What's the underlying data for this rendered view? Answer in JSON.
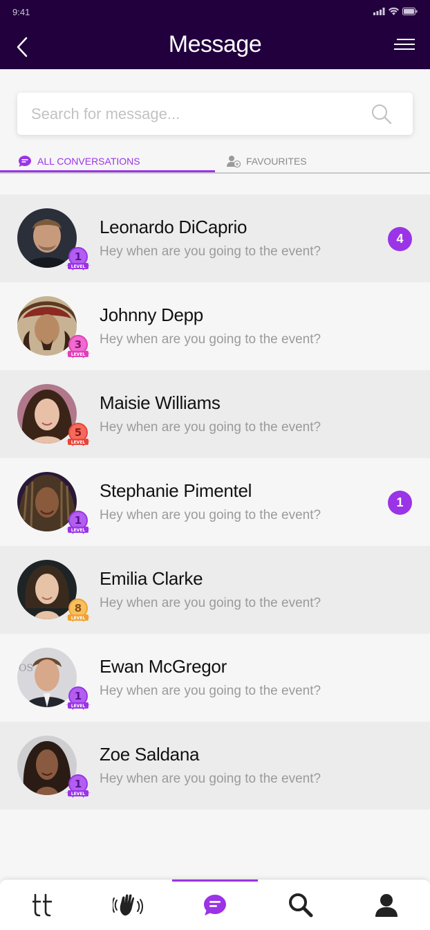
{
  "status_bar": {
    "time": "9:41"
  },
  "header": {
    "title": "Message"
  },
  "search": {
    "placeholder": "Search for message..."
  },
  "tabs": [
    {
      "label": "ALL CONVERSATIONS",
      "active": true
    },
    {
      "label": "FAVOURITES",
      "active": false
    }
  ],
  "level_label": "LEVEL",
  "conversations": [
    {
      "name": "Leonardo DiCaprio",
      "preview": "Hey when are you going to the event?",
      "level": "1",
      "level_color": "#9a34e6",
      "unread": "4"
    },
    {
      "name": "Johnny Depp",
      "preview": "Hey when are you going to the event?",
      "level": "3",
      "level_color": "#e040b8",
      "unread": ""
    },
    {
      "name": "Maisie Williams",
      "preview": "Hey when are you going to the event?",
      "level": "5",
      "level_color": "#e8443a",
      "unread": ""
    },
    {
      "name": "Stephanie Pimentel",
      "preview": "Hey when are you going to the event?",
      "level": "1",
      "level_color": "#9a34e6",
      "unread": "1"
    },
    {
      "name": "Emilia Clarke",
      "preview": "Hey when are you going to the event?",
      "level": "8",
      "level_color": "#f0a030",
      "unread": ""
    },
    {
      "name": "Ewan McGregor",
      "preview": "Hey when are you going to the event?",
      "level": "1",
      "level_color": "#9a34e6",
      "unread": ""
    },
    {
      "name": "Zoe Saldana",
      "preview": "Hey when are you going to the event?",
      "level": "1",
      "level_color": "#9a34e6",
      "unread": ""
    }
  ],
  "bottom_nav": [
    {
      "icon": "tt-logo-icon"
    },
    {
      "icon": "wave-hand-icon"
    },
    {
      "icon": "chat-bubble-icon",
      "active": true
    },
    {
      "icon": "search-icon"
    },
    {
      "icon": "profile-icon"
    }
  ],
  "colors": {
    "header_bg": "#22003e",
    "accent": "#9a34e6"
  }
}
